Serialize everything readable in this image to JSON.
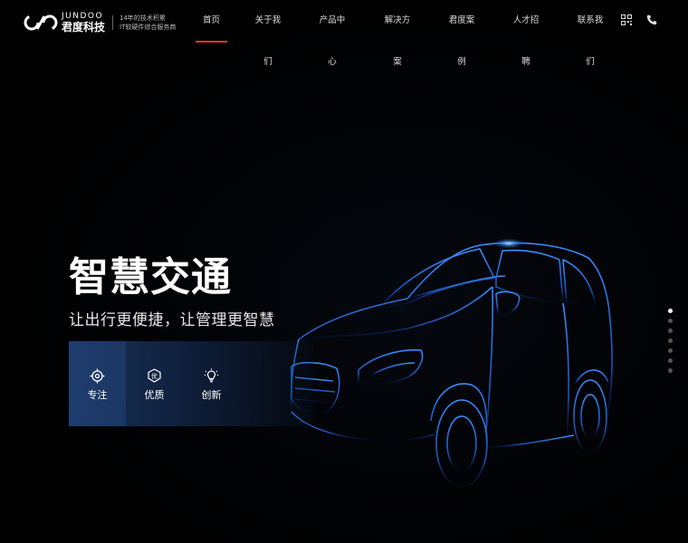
{
  "brand": {
    "name_en": "JUNDOO",
    "name_cn": "君度科技",
    "slogan_line1": "14年的技术积累",
    "slogan_line2": "IT软硬件综合服务商"
  },
  "nav": {
    "items": [
      {
        "label": "首页",
        "active": true
      },
      {
        "label": "关于我们",
        "active": false
      },
      {
        "label": "产品中心",
        "active": false
      },
      {
        "label": "解决方案",
        "active": false
      },
      {
        "label": "君度案例",
        "active": false
      },
      {
        "label": "人才招聘",
        "active": false
      },
      {
        "label": "联系我们",
        "active": false
      }
    ],
    "icons": [
      "qrcode-icon",
      "phone-icon"
    ],
    "active_color": "#e2372b"
  },
  "hero": {
    "title": "智慧交通",
    "subtitle": "让出行更便捷，让管理更智慧",
    "features": [
      {
        "label": "专注",
        "icon": "target-icon"
      },
      {
        "label": "优质",
        "icon": "quality-badge-icon"
      },
      {
        "label": "创新",
        "icon": "lightbulb-icon"
      }
    ]
  },
  "slider": {
    "total": 7,
    "active_index": 0
  },
  "colors": {
    "background": "#000000",
    "car_line": "#2f7bff",
    "feature_panel": "#1e3c6e"
  }
}
